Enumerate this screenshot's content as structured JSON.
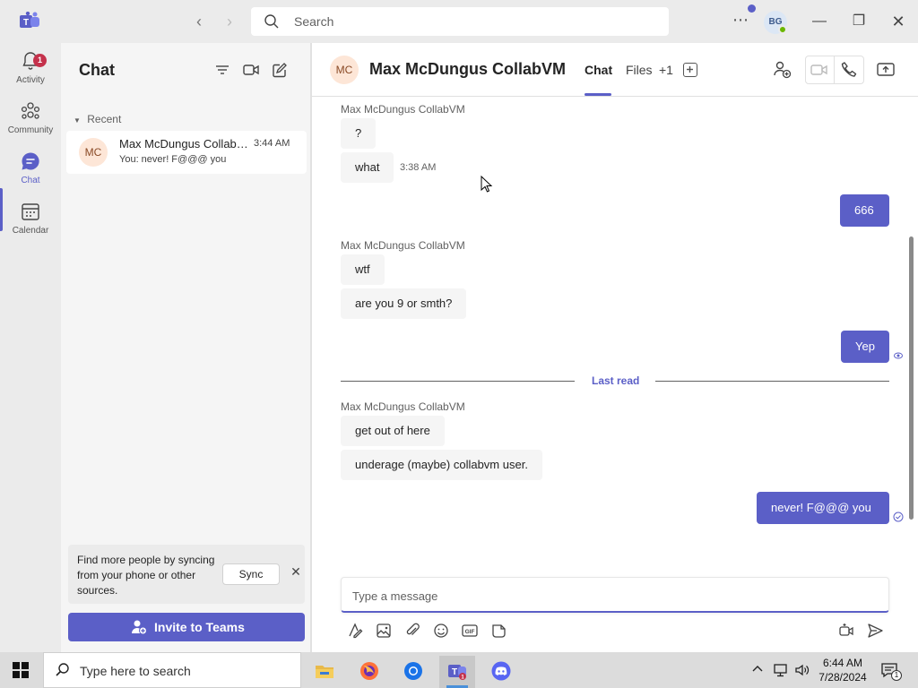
{
  "titlebar": {
    "search_placeholder": "Search",
    "avatar_initials": "BG"
  },
  "rail": {
    "items": [
      {
        "label": "Activity",
        "icon": "bell-icon",
        "badge": "1"
      },
      {
        "label": "Community",
        "icon": "community-icon"
      },
      {
        "label": "Chat",
        "icon": "chat-icon",
        "active": true
      },
      {
        "label": "Calendar",
        "icon": "calendar-icon"
      }
    ]
  },
  "chatlist": {
    "title": "Chat",
    "section": "Recent",
    "items": [
      {
        "initials": "MC",
        "name": "Max McDungus CollabVM",
        "time": "3:44 AM",
        "preview": "You: never! F@@@ you"
      }
    ],
    "sync_text": "Find more people by syncing from your phone or other sources.",
    "sync_button": "Sync",
    "invite_button": "Invite to Teams"
  },
  "header": {
    "initials": "MC",
    "name": "Max McDungus CollabVM",
    "tabs": [
      {
        "label": "Chat",
        "active": true
      },
      {
        "label": "Files"
      },
      {
        "label": "+1"
      }
    ]
  },
  "messages": [
    {
      "sender": "Max McDungus CollabVM"
    },
    {
      "text": "?",
      "dir": "in"
    },
    {
      "text": "what",
      "dir": "in",
      "time": "3:38 AM"
    },
    {
      "text": "666",
      "dir": "out"
    },
    {
      "sender": "Max McDungus CollabVM"
    },
    {
      "text": "wtf",
      "dir": "in"
    },
    {
      "text": "are you 9 or smth?",
      "dir": "in"
    },
    {
      "text": "Yep",
      "dir": "out"
    },
    {
      "divider": "Last read"
    },
    {
      "sender": "Max McDungus CollabVM"
    },
    {
      "text": "get out of here",
      "dir": "in"
    },
    {
      "text": "underage (maybe) collabvm user.",
      "dir": "in"
    },
    {
      "text": "never! F@@@ you",
      "dir": "out"
    }
  ],
  "compose": {
    "placeholder": "Type a message"
  },
  "taskbar": {
    "search_placeholder": "Type here to search",
    "time": "6:44 AM",
    "date": "7/28/2024",
    "notification_count": "1"
  },
  "colors": {
    "accent": "#5b5fc7",
    "rail_bg": "#ebebeb",
    "bubble_in": "#f5f5f5"
  }
}
